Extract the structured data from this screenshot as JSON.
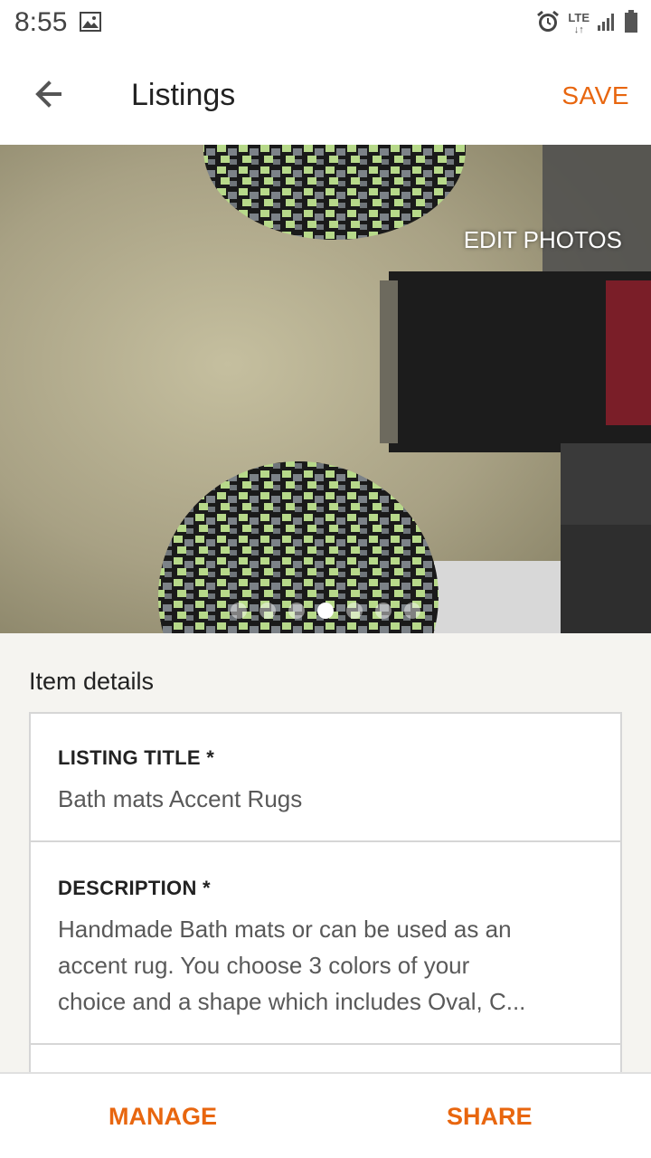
{
  "status_bar": {
    "time": "8:55",
    "network": "LTE",
    "icons": [
      "image-icon",
      "alarm-icon",
      "signal-icon",
      "battery-icon"
    ]
  },
  "app_bar": {
    "title": "Listings",
    "save_label": "SAVE",
    "back_icon": "arrow-left-icon"
  },
  "photo": {
    "edit_label": "EDIT PHOTOS",
    "dot_count": 7,
    "active_dot": 3
  },
  "item_details": {
    "section_title": "Item details",
    "fields": [
      {
        "label": "LISTING TITLE *",
        "value": "Bath mats  Accent Rugs"
      },
      {
        "label": "DESCRIPTION *",
        "value_lines": [
          "Handmade Bath mats or can be used as an",
          "accent rug. You choose 3 colors of your",
          "choice and a shape which includes Oval, C..."
        ]
      }
    ]
  },
  "bottom_bar": {
    "manage_label": "MANAGE",
    "share_label": "SHARE"
  },
  "colors": {
    "accent": "#e8660f",
    "background": "#f5f4f0"
  }
}
